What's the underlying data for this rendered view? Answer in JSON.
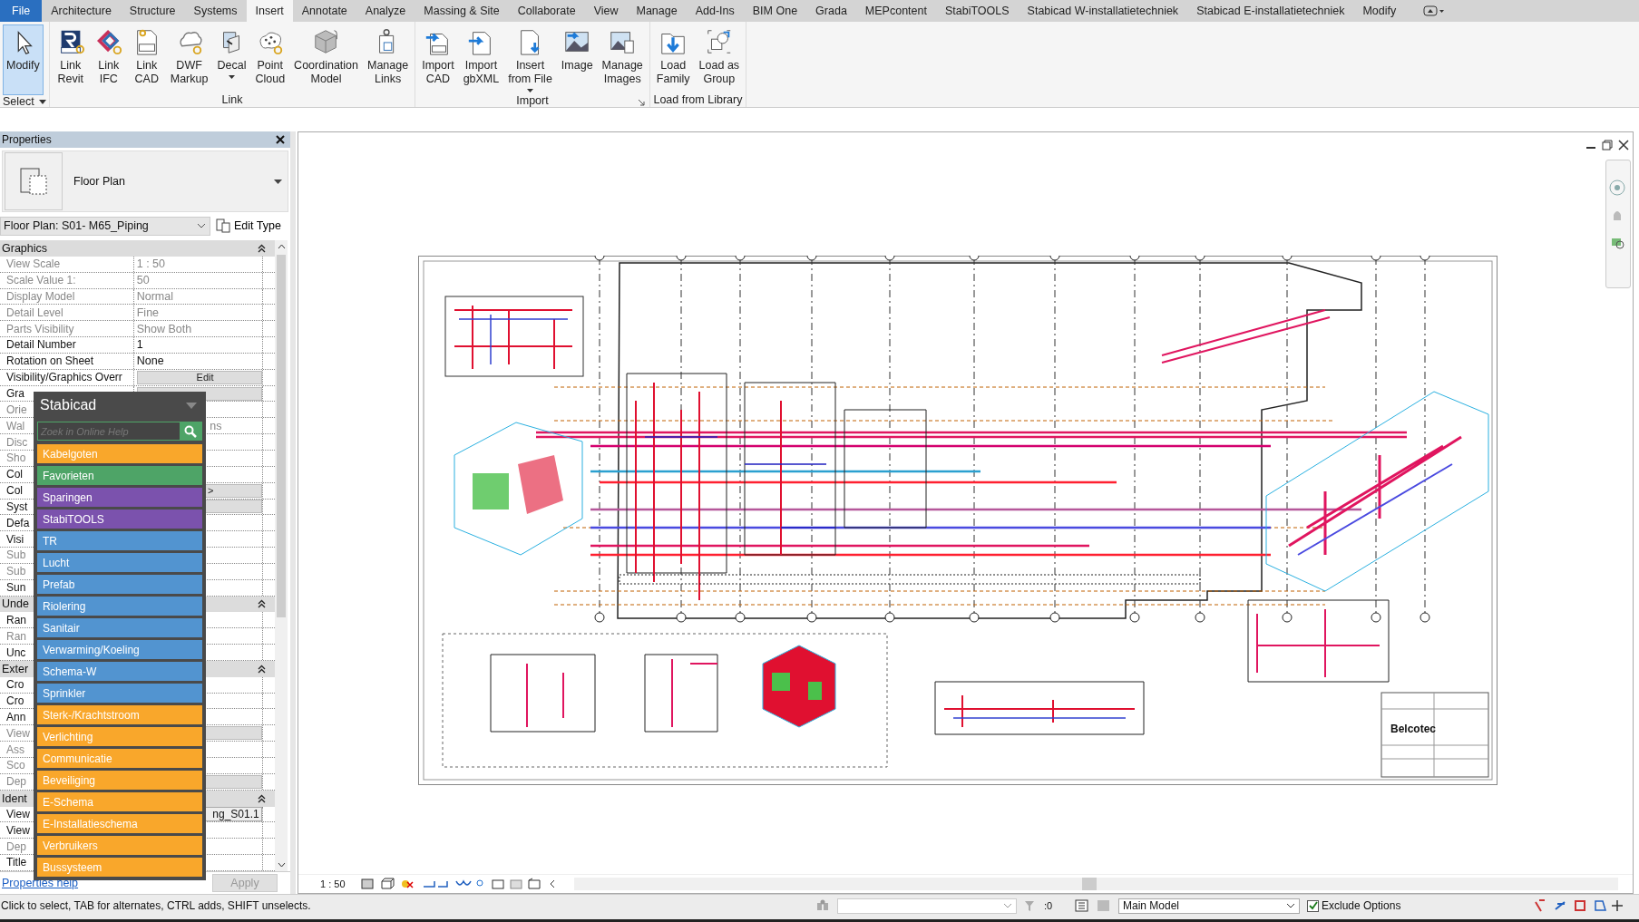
{
  "menu_tabs": [
    {
      "label": "File",
      "kind": "file",
      "selected": false
    },
    {
      "label": "Architecture",
      "kind": "tab",
      "selected": false
    },
    {
      "label": "Structure",
      "kind": "tab",
      "selected": false
    },
    {
      "label": "Systems",
      "kind": "tab",
      "selected": false
    },
    {
      "label": "Insert",
      "kind": "tab",
      "selected": true
    },
    {
      "label": "Annotate",
      "kind": "tab",
      "selected": false
    },
    {
      "label": "Analyze",
      "kind": "tab",
      "selected": false
    },
    {
      "label": "Massing & Site",
      "kind": "tab",
      "selected": false
    },
    {
      "label": "Collaborate",
      "kind": "tab",
      "selected": false
    },
    {
      "label": "View",
      "kind": "tab",
      "selected": false
    },
    {
      "label": "Manage",
      "kind": "tab",
      "selected": false
    },
    {
      "label": "Add-Ins",
      "kind": "tab",
      "selected": false
    },
    {
      "label": "BIM One",
      "kind": "tab",
      "selected": false
    },
    {
      "label": "Grada",
      "kind": "tab",
      "selected": false
    },
    {
      "label": "MEPcontent",
      "kind": "tab",
      "selected": false
    },
    {
      "label": "StabiTOOLS",
      "kind": "tab",
      "selected": false
    },
    {
      "label": "Stabicad W-installatietechniek",
      "kind": "tab",
      "selected": false
    },
    {
      "label": "Stabicad E-installatietechniek",
      "kind": "tab",
      "selected": false
    },
    {
      "label": "Modify",
      "kind": "tab",
      "selected": false
    }
  ],
  "ribbon": [
    {
      "label": "Select",
      "has_menu": true,
      "launcher": false,
      "buttons": [
        {
          "label": "Modify",
          "selected": true,
          "has_menu": false
        }
      ]
    },
    {
      "label": "Link",
      "has_menu": false,
      "launcher": false,
      "buttons": [
        {
          "label": "Link\nRevit",
          "selected": false,
          "has_menu": false
        },
        {
          "label": "Link\nIFC",
          "selected": false,
          "has_menu": false
        },
        {
          "label": "Link\nCAD",
          "selected": false,
          "has_menu": false
        },
        {
          "label": "DWF\nMarkup",
          "selected": false,
          "has_menu": false
        },
        {
          "label": "Decal",
          "selected": false,
          "has_menu": true
        },
        {
          "label": "Point\nCloud",
          "selected": false,
          "has_menu": false
        },
        {
          "label": "Coordination\nModel",
          "selected": false,
          "has_menu": false
        },
        {
          "label": "Manage\nLinks",
          "selected": false,
          "has_menu": false
        }
      ]
    },
    {
      "label": "Import",
      "has_menu": false,
      "launcher": true,
      "buttons": [
        {
          "label": "Import\nCAD",
          "selected": false,
          "has_menu": false
        },
        {
          "label": "Import\ngbXML",
          "selected": false,
          "has_menu": false
        },
        {
          "label": "Insert\nfrom File",
          "selected": false,
          "has_menu": true
        },
        {
          "label": "Image",
          "selected": false,
          "has_menu": false
        },
        {
          "label": "Manage\nImages",
          "selected": false,
          "has_menu": false
        }
      ]
    },
    {
      "label": "Load from Library",
      "has_menu": false,
      "launcher": false,
      "buttons": [
        {
          "label": "Load\nFamily",
          "selected": false,
          "has_menu": false
        },
        {
          "label": "Load as\nGroup",
          "selected": false,
          "has_menu": false
        }
      ]
    }
  ],
  "properties": {
    "title": "Properties",
    "type_name": "Floor Plan",
    "instance": "Floor Plan: S01- M65_Piping",
    "edit_type": "Edit Type",
    "rows": [
      {
        "kind": "section",
        "label": "Graphics"
      },
      {
        "kind": "text",
        "label": "View Scale",
        "value": "1 : 50",
        "disabled": true
      },
      {
        "kind": "text",
        "label": "Scale Value    1:",
        "value": "50",
        "disabled": true
      },
      {
        "kind": "text",
        "label": "Display Model",
        "value": "Normal",
        "disabled": true
      },
      {
        "kind": "text",
        "label": "Detail Level",
        "value": "Fine",
        "disabled": true
      },
      {
        "kind": "text",
        "label": "Parts Visibility",
        "value": "Show Both",
        "disabled": true
      },
      {
        "kind": "text",
        "label": "Detail Number",
        "value": "1",
        "disabled": false
      },
      {
        "kind": "text",
        "label": "Rotation on Sheet",
        "value": "None",
        "disabled": false
      },
      {
        "kind": "button",
        "label": "Visibility/Graphics Overr",
        "value": "Edit",
        "disabled": false
      },
      {
        "kind": "button",
        "label": "Gra",
        "value": "",
        "disabled": false
      },
      {
        "kind": "text",
        "label": "Orie",
        "value": "",
        "disabled": true
      },
      {
        "kind": "tail",
        "label": "Wal",
        "value": "ns",
        "disabled": true
      },
      {
        "kind": "text",
        "label": "Disc",
        "value": "",
        "disabled": true
      },
      {
        "kind": "text",
        "label": "Sho",
        "value": "",
        "disabled": true
      },
      {
        "kind": "text",
        "label": "Col",
        "value": "",
        "disabled": false
      },
      {
        "kind": "button",
        "label": "Col",
        "value": ">",
        "disabled": false
      },
      {
        "kind": "button",
        "label": "Syst",
        "value": "",
        "disabled": false
      },
      {
        "kind": "text",
        "label": "Defa",
        "value": "",
        "disabled": false
      },
      {
        "kind": "text",
        "label": "Visi",
        "value": "",
        "disabled": false
      },
      {
        "kind": "text",
        "label": "Sub",
        "value": "",
        "disabled": true
      },
      {
        "kind": "text",
        "label": "Sub",
        "value": "",
        "disabled": true
      },
      {
        "kind": "text",
        "label": "Sun",
        "value": "",
        "disabled": false
      },
      {
        "kind": "section",
        "label": "Unde"
      },
      {
        "kind": "text",
        "label": "Ran",
        "value": "",
        "disabled": false
      },
      {
        "kind": "text",
        "label": "Ran",
        "value": "",
        "disabled": true
      },
      {
        "kind": "text",
        "label": "Unc",
        "value": "",
        "disabled": false
      },
      {
        "kind": "section",
        "label": "Exter"
      },
      {
        "kind": "text",
        "label": "Cro",
        "value": "",
        "disabled": false
      },
      {
        "kind": "text",
        "label": "Cro",
        "value": "",
        "disabled": false
      },
      {
        "kind": "text",
        "label": "Ann",
        "value": "",
        "disabled": false
      },
      {
        "kind": "button",
        "label": "View",
        "value": "",
        "disabled": true
      },
      {
        "kind": "text",
        "label": "Ass",
        "value": "",
        "disabled": true
      },
      {
        "kind": "text",
        "label": "Sco",
        "value": "",
        "disabled": true
      },
      {
        "kind": "button",
        "label": "Dep",
        "value": "",
        "disabled": true
      },
      {
        "kind": "section",
        "label": "Ident"
      },
      {
        "kind": "field",
        "label": "View",
        "value": "ng_S01.1",
        "disabled": false
      },
      {
        "kind": "text",
        "label": "View",
        "value": "",
        "disabled": false
      },
      {
        "kind": "text",
        "label": "Dep",
        "value": "",
        "disabled": true
      },
      {
        "kind": "text",
        "label": "Title",
        "value": "",
        "disabled": false
      }
    ],
    "help_link": "Properties help",
    "apply": "Apply"
  },
  "stabicad": {
    "title": "Stabicad",
    "search": {
      "placeholder": "Zoek in Online Help"
    },
    "items": [
      {
        "label": "Kabelgoten",
        "color": "#f9a72b"
      },
      {
        "label": "Favorieten",
        "color": "#4ea467"
      },
      {
        "label": "Sparingen",
        "color": "#7b52ad"
      },
      {
        "label": "StabiTOOLS",
        "color": "#7b52ad"
      },
      {
        "label": "TR",
        "color": "#5294d0"
      },
      {
        "label": "Lucht",
        "color": "#5294d0"
      },
      {
        "label": "Prefab",
        "color": "#5294d0"
      },
      {
        "label": "Riolering",
        "color": "#5294d0"
      },
      {
        "label": "Sanitair",
        "color": "#5294d0"
      },
      {
        "label": "Verwarming/Koeling",
        "color": "#5294d0"
      },
      {
        "label": "Schema-W",
        "color": "#5294d0"
      },
      {
        "label": "Sprinkler",
        "color": "#5294d0"
      },
      {
        "label": "Sterk-/Krachtstroom",
        "color": "#f9a72b"
      },
      {
        "label": "Verlichting",
        "color": "#f9a72b"
      },
      {
        "label": "Communicatie",
        "color": "#f9a72b"
      },
      {
        "label": "Beveiliging",
        "color": "#f9a72b"
      },
      {
        "label": "E-Schema",
        "color": "#f9a72b"
      },
      {
        "label": "E-Installatieschema",
        "color": "#f9a72b"
      },
      {
        "label": "Verbruikers",
        "color": "#f9a72b"
      },
      {
        "label": "Bussysteem",
        "color": "#f9a72b"
      }
    ]
  },
  "sheet": {
    "logo_text": "Belcotec"
  },
  "view_bar": {
    "scale": "1 : 50"
  },
  "status_bar": {
    "message": "Click to select, TAB for alternates, CTRL adds, SHIFT unselects.",
    "selection_count": ":0",
    "model": "Main Model",
    "exclude_options": {
      "label": "Exclude Options",
      "checked": true
    }
  }
}
